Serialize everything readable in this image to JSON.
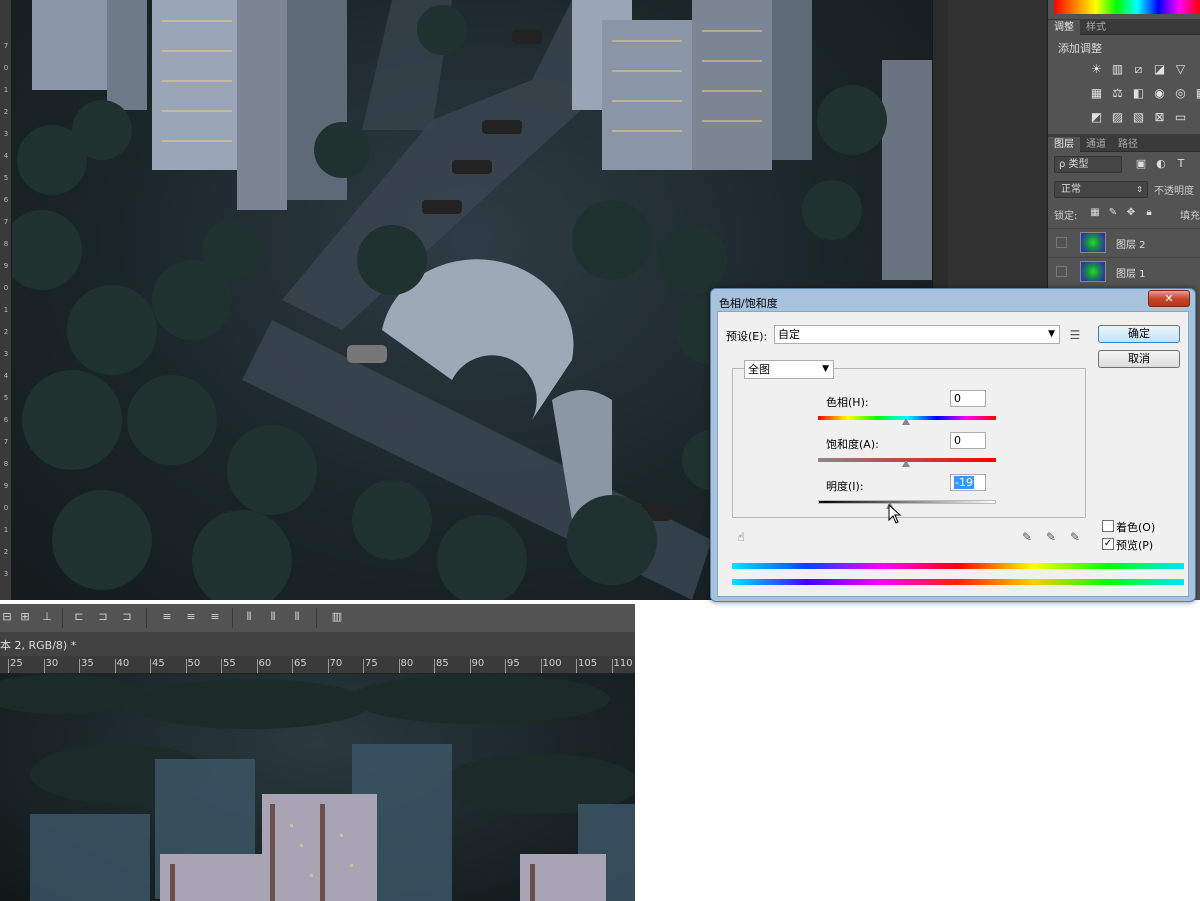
{
  "ruler_left_ticks": [
    "7",
    "0",
    "1",
    "2",
    "3",
    "4",
    "5",
    "6",
    "7",
    "8",
    "9",
    "0",
    "1",
    "2",
    "3",
    "4",
    "5",
    "6",
    "7",
    "8",
    "9",
    "0",
    "1",
    "2",
    "3"
  ],
  "adjust_panel": {
    "tabs": [
      "调整",
      "样式"
    ],
    "title": "添加调整",
    "icons_row1": [
      "brightness-icon",
      "levels-icon",
      "curves-icon",
      "exposure-icon",
      "vibrance-icon"
    ],
    "icons_row2": [
      "hue-saturation-icon",
      "color-balance-icon",
      "black-white-icon",
      "photo-filter-icon",
      "channel-mixer-icon",
      "color-lookup-icon"
    ],
    "icons_row3": [
      "invert-icon",
      "posterize-icon",
      "threshold-icon",
      "selective-color-icon",
      "gradient-map-icon"
    ]
  },
  "layers_panel": {
    "tabs": [
      "图层",
      "通道",
      "路径"
    ],
    "filter_label": "ρ 类型",
    "blend_mode": "正常",
    "opacity_label": "不透明度",
    "lock_label": "锁定:",
    "fill_label": "填充",
    "layers": [
      {
        "name": "图层 2"
      },
      {
        "name": "图层 1"
      }
    ]
  },
  "dialog": {
    "title": "色相/饱和度",
    "close": "✕",
    "preset_label": "预设(E):",
    "preset_value": "自定",
    "ok": "确定",
    "cancel": "取消",
    "channel": "全图",
    "hue_label": "色相(H):",
    "hue_value": "0",
    "saturation_label": "饱和度(A):",
    "saturation_value": "0",
    "lightness_label": "明度(I):",
    "lightness_value": "-19",
    "colorize_label": "着色(O)",
    "preview_label": "预览(P)",
    "colorize_checked": false,
    "preview_checked": true
  },
  "document2": {
    "tab_title": "本 2, RGB/8) *",
    "ruler_ticks": [
      "25",
      "30",
      "35",
      "40",
      "45",
      "50",
      "55",
      "60",
      "65",
      "70",
      "75",
      "80",
      "85",
      "90",
      "95",
      "100",
      "105",
      "110"
    ]
  }
}
